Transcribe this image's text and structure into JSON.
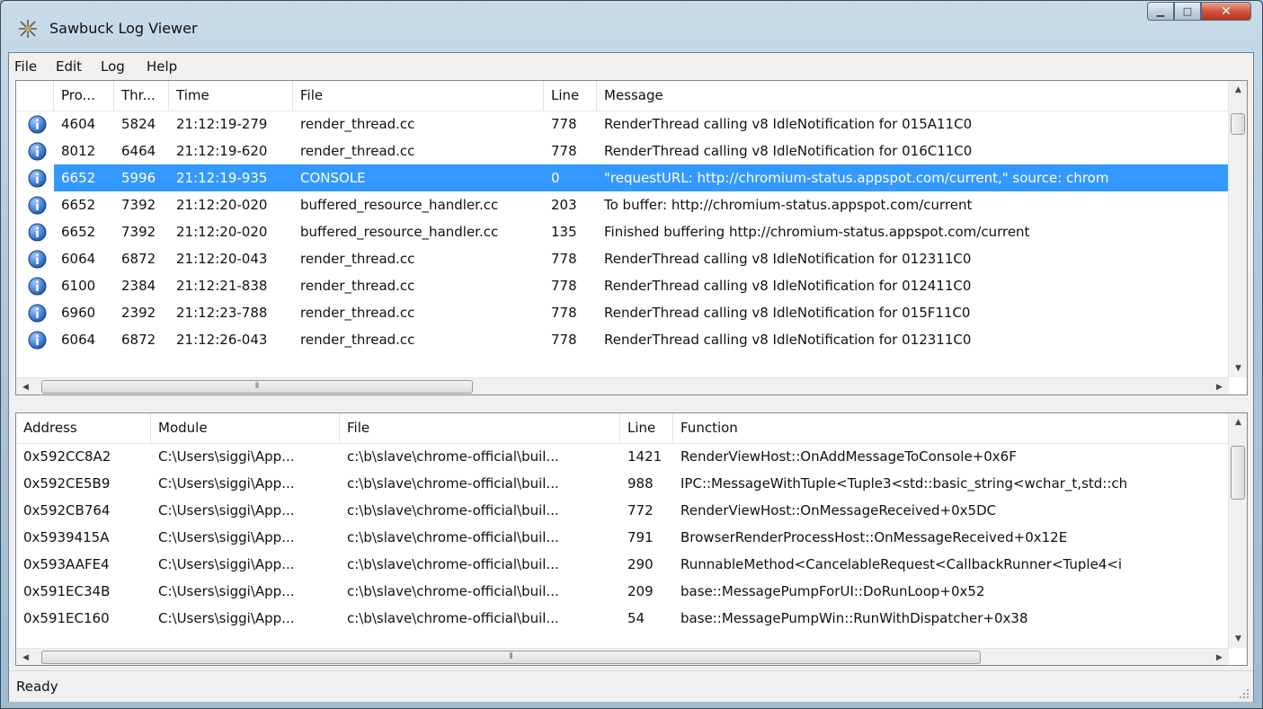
{
  "window": {
    "title": "Sawbuck Log Viewer"
  },
  "menu": [
    "File",
    "Edit",
    "Log",
    "Help"
  ],
  "log_table": {
    "columns": [
      "Pro...",
      "Thr...",
      "Time",
      "File",
      "Line",
      "Message"
    ],
    "rows": [
      [
        "4604",
        "5824",
        "21:12:19-279",
        "render_thread.cc",
        "778",
        "RenderThread calling v8 IdleNotification for 015A11C0"
      ],
      [
        "8012",
        "6464",
        "21:12:19-620",
        "render_thread.cc",
        "778",
        "RenderThread calling v8 IdleNotification for 016C11C0"
      ],
      [
        "6652",
        "5996",
        "21:12:19-935",
        "CONSOLE",
        "0",
        "\"requestURL: http://chromium-status.appspot.com/current,\" source: chrom"
      ],
      [
        "6652",
        "7392",
        "21:12:20-020",
        "buffered_resource_handler.cc",
        "203",
        "To buffer: http://chromium-status.appspot.com/current"
      ],
      [
        "6652",
        "7392",
        "21:12:20-020",
        "buffered_resource_handler.cc",
        "135",
        "Finished buffering http://chromium-status.appspot.com/current"
      ],
      [
        "6064",
        "6872",
        "21:12:20-043",
        "render_thread.cc",
        "778",
        "RenderThread calling v8 IdleNotification for 012311C0"
      ],
      [
        "6100",
        "2384",
        "21:12:21-838",
        "render_thread.cc",
        "778",
        "RenderThread calling v8 IdleNotification for 012411C0"
      ],
      [
        "6960",
        "2392",
        "21:12:23-788",
        "render_thread.cc",
        "778",
        "RenderThread calling v8 IdleNotification for 015F11C0"
      ],
      [
        "6064",
        "6872",
        "21:12:26-043",
        "render_thread.cc",
        "778",
        "RenderThread calling v8 IdleNotification for 012311C0"
      ]
    ],
    "selected_row": 2
  },
  "stack_table": {
    "columns": [
      "Address",
      "Module",
      "File",
      "Line",
      "Function"
    ],
    "rows": [
      [
        "0x592CC8A2",
        "C:\\Users\\siggi\\App...",
        "c:\\b\\slave\\chrome-official\\buil...",
        "1421",
        "RenderViewHost::OnAddMessageToConsole+0x6F"
      ],
      [
        "0x592CE5B9",
        "C:\\Users\\siggi\\App...",
        "c:\\b\\slave\\chrome-official\\buil...",
        "988",
        "IPC::MessageWithTuple<Tuple3<std::basic_string<wchar_t,std::ch"
      ],
      [
        "0x592CB764",
        "C:\\Users\\siggi\\App...",
        "c:\\b\\slave\\chrome-official\\buil...",
        "772",
        "RenderViewHost::OnMessageReceived+0x5DC"
      ],
      [
        "0x5939415A",
        "C:\\Users\\siggi\\App...",
        "c:\\b\\slave\\chrome-official\\buil...",
        "791",
        "BrowserRenderProcessHost::OnMessageReceived+0x12E"
      ],
      [
        "0x593AAFE4",
        "C:\\Users\\siggi\\App...",
        "c:\\b\\slave\\chrome-official\\buil...",
        "290",
        "RunnableMethod<CancelableRequest<CallbackRunner<Tuple4<i"
      ],
      [
        "0x591EC34B",
        "C:\\Users\\siggi\\App...",
        "c:\\b\\slave\\chrome-official\\buil...",
        "209",
        "base::MessagePumpForUI::DoRunLoop+0x52"
      ],
      [
        "0x591EC160",
        "C:\\Users\\siggi\\App...",
        "c:\\b\\slave\\chrome-official\\buil...",
        "54",
        "base::MessagePumpWin::RunWithDispatcher+0x38"
      ]
    ]
  },
  "status": {
    "text": "Ready"
  },
  "colors": {
    "selection": "#3399ff",
    "info_icon": "#1f5fbf"
  }
}
